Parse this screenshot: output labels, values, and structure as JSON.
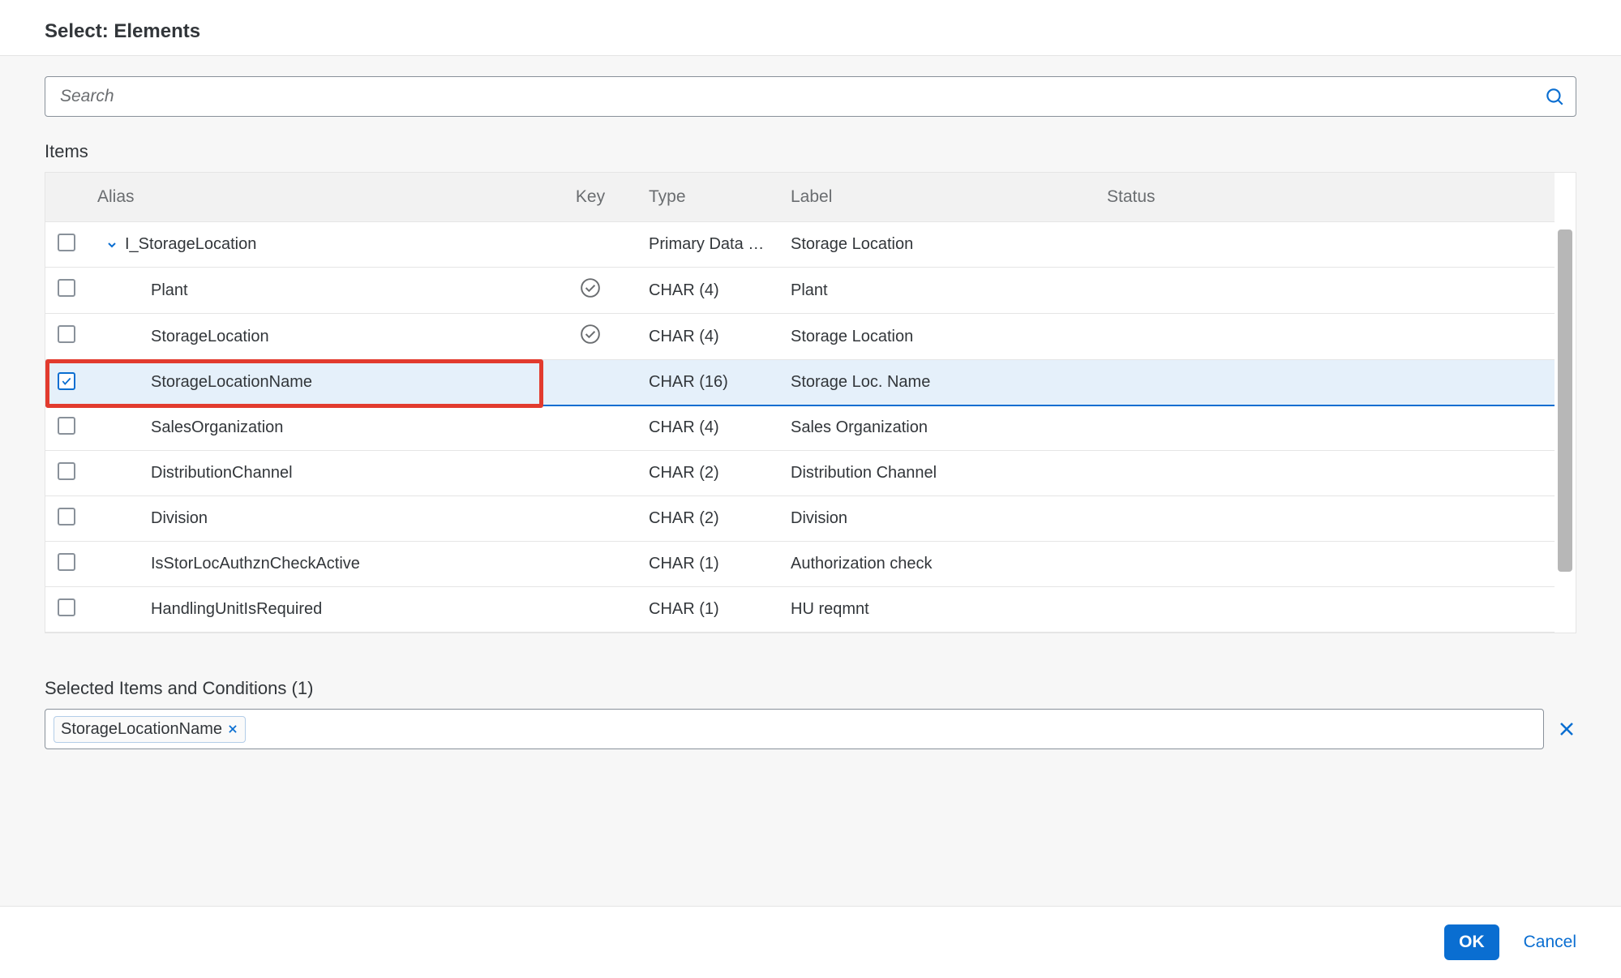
{
  "dialog": {
    "title": "Select: Elements"
  },
  "search": {
    "placeholder": "Search"
  },
  "items_section": {
    "title": "Items"
  },
  "columns": {
    "alias": "Alias",
    "key": "Key",
    "type": "Type",
    "label": "Label",
    "status": "Status"
  },
  "rows": [
    {
      "alias": "I_StorageLocation",
      "indent": 0,
      "expandable": true,
      "checked": false,
      "key": false,
      "type": "Primary Data S...",
      "label": "Storage Location",
      "status": "",
      "highlighted": false
    },
    {
      "alias": "Plant",
      "indent": 1,
      "expandable": false,
      "checked": false,
      "key": true,
      "type": "CHAR (4)",
      "label": "Plant",
      "status": "",
      "highlighted": false
    },
    {
      "alias": "StorageLocation",
      "indent": 1,
      "expandable": false,
      "checked": false,
      "key": true,
      "type": "CHAR (4)",
      "label": "Storage Location",
      "status": "",
      "highlighted": false
    },
    {
      "alias": "StorageLocationName",
      "indent": 1,
      "expandable": false,
      "checked": true,
      "key": false,
      "type": "CHAR (16)",
      "label": "Storage Loc. Name",
      "status": "",
      "highlighted": true
    },
    {
      "alias": "SalesOrganization",
      "indent": 1,
      "expandable": false,
      "checked": false,
      "key": false,
      "type": "CHAR (4)",
      "label": "Sales Organization",
      "status": "",
      "highlighted": false
    },
    {
      "alias": "DistributionChannel",
      "indent": 1,
      "expandable": false,
      "checked": false,
      "key": false,
      "type": "CHAR (2)",
      "label": "Distribution Channel",
      "status": "",
      "highlighted": false
    },
    {
      "alias": "Division",
      "indent": 1,
      "expandable": false,
      "checked": false,
      "key": false,
      "type": "CHAR (2)",
      "label": "Division",
      "status": "",
      "highlighted": false
    },
    {
      "alias": "IsStorLocAuthznCheckActive",
      "indent": 1,
      "expandable": false,
      "checked": false,
      "key": false,
      "type": "CHAR (1)",
      "label": "Authorization check",
      "status": "",
      "highlighted": false
    },
    {
      "alias": "HandlingUnitIsRequired",
      "indent": 1,
      "expandable": false,
      "checked": false,
      "key": false,
      "type": "CHAR (1)",
      "label": "HU reqmnt",
      "status": "",
      "highlighted": false
    }
  ],
  "selected_section": {
    "title": "Selected Items and Conditions (1)"
  },
  "tokens": [
    {
      "label": "StorageLocationName"
    }
  ],
  "footer": {
    "ok": "OK",
    "cancel": "Cancel"
  }
}
